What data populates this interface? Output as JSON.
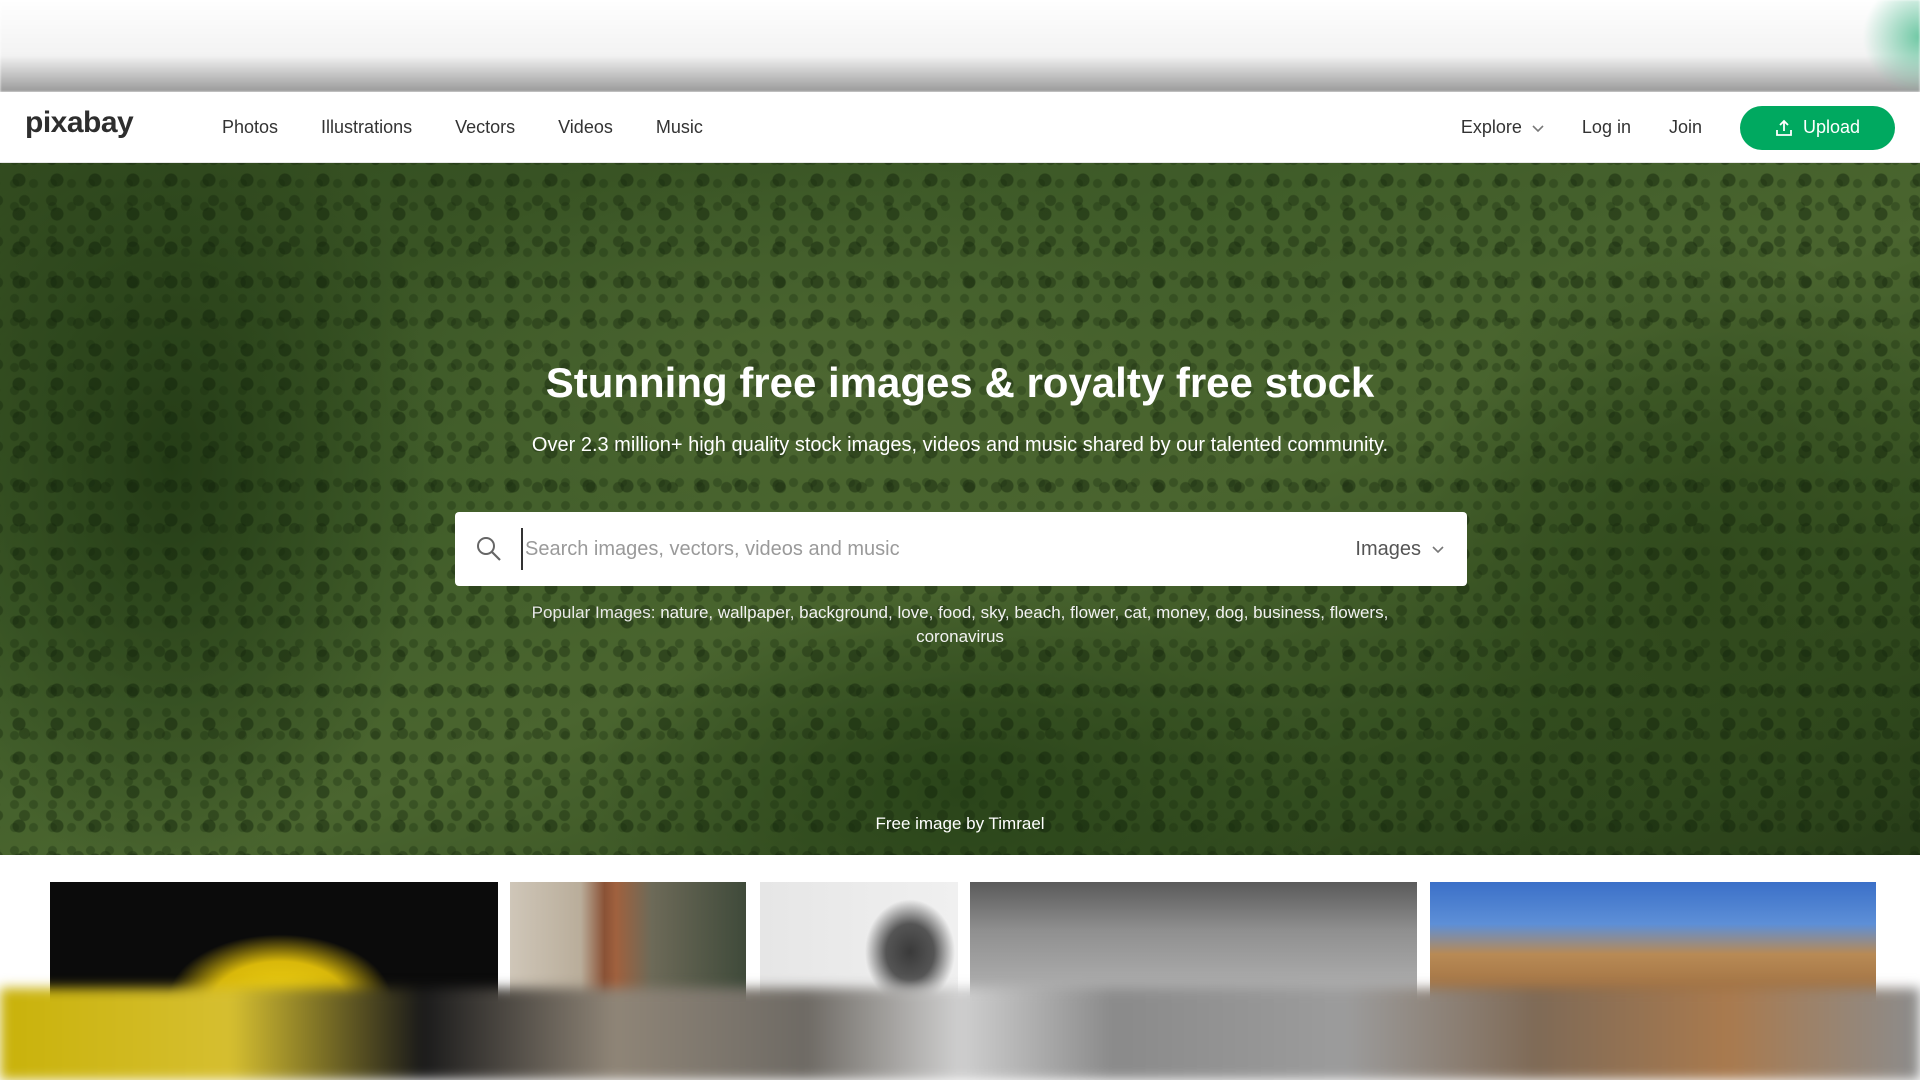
{
  "header": {
    "logo": "pixabay",
    "nav": [
      "Photos",
      "Illustrations",
      "Vectors",
      "Videos",
      "Music"
    ],
    "explore": "Explore",
    "login": "Log in",
    "join": "Join",
    "upload": "Upload"
  },
  "hero": {
    "title": "Stunning free images & royalty free stock",
    "subtitle": "Over 2.3 million+ high quality stock images, videos and music shared by our talented community.",
    "search_placeholder": "Search images, vectors, videos and music",
    "search_type": "Images",
    "popular_label": "Popular Images:",
    "popular_tags": [
      "nature",
      "wallpaper",
      "background",
      "love",
      "food",
      "sky",
      "beach",
      "flower",
      "cat",
      "money",
      "dog",
      "business",
      "flowers",
      "coronavirus"
    ],
    "credit": "Free image by Timrael"
  },
  "colors": {
    "accent": "#00a960",
    "hero_green": "#4f7233"
  }
}
